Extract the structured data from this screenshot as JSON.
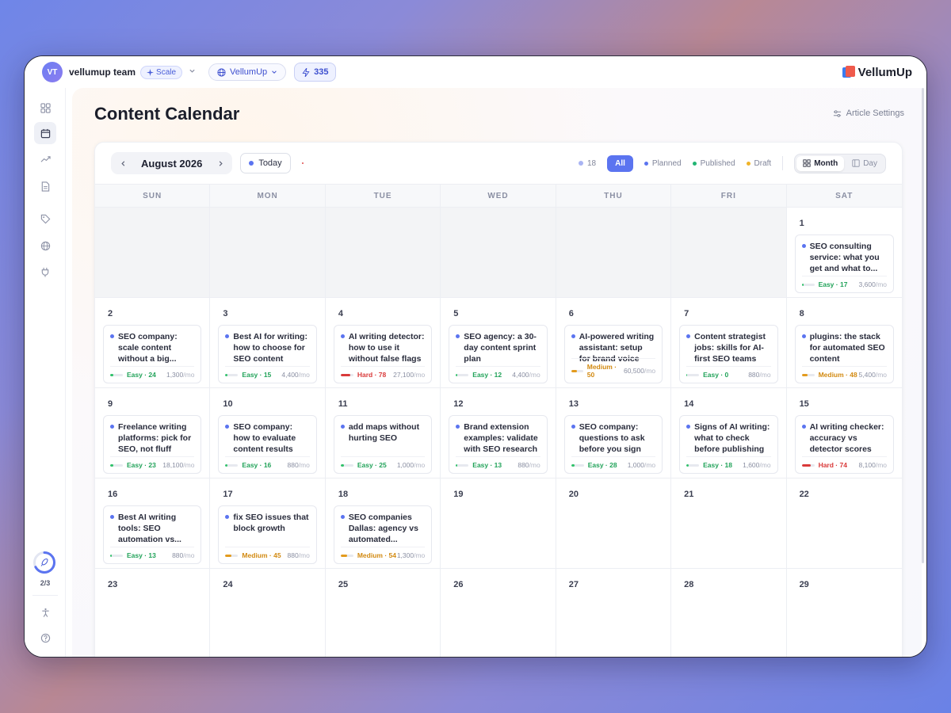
{
  "topbar": {
    "avatar_initials": "VT",
    "team_name": "vellumup team",
    "plan_label": "Scale",
    "workspace_label": "VellumUp",
    "credits": "335",
    "brand_name": "VellumUp"
  },
  "sidebar": {
    "progress_label": "2/3",
    "progress_fraction": 0.67
  },
  "page": {
    "title": "Content Calendar",
    "article_settings_label": "Article Settings"
  },
  "calendar": {
    "month_label": "August 2026",
    "today_label": "Today",
    "total_count": "18",
    "filters": {
      "all": "All",
      "planned": "Planned",
      "published": "Published",
      "draft": "Draft"
    },
    "views": {
      "month": "Month",
      "day": "Day"
    },
    "weekdays": [
      "SUN",
      "MON",
      "TUE",
      "WED",
      "THU",
      "FRI",
      "SAT"
    ],
    "leading_empty_days": 6,
    "days": [
      {
        "day": "1",
        "article": {
          "title": "SEO consulting service: what you get and what to...",
          "difficulty": "Easy · 17",
          "level": "easy",
          "score": 17,
          "volume": "3,600",
          "unit": "/mo"
        }
      },
      {
        "day": "2",
        "article": {
          "title": "SEO company: scale content without a big...",
          "difficulty": "Easy · 24",
          "level": "easy",
          "score": 24,
          "volume": "1,300",
          "unit": "/mo"
        }
      },
      {
        "day": "3",
        "article": {
          "title": "Best AI for writing: how to choose for SEO content",
          "difficulty": "Easy · 15",
          "level": "easy",
          "score": 15,
          "volume": "4,400",
          "unit": "/mo"
        }
      },
      {
        "day": "4",
        "article": {
          "title": "AI writing detector: how to use it without false flags",
          "difficulty": "Hard · 78",
          "level": "hard",
          "score": 78,
          "volume": "27,100",
          "unit": "/mo"
        }
      },
      {
        "day": "5",
        "article": {
          "title": "SEO agency: a 30-day content sprint plan",
          "difficulty": "Easy · 12",
          "level": "easy",
          "score": 12,
          "volume": "4,400",
          "unit": "/mo"
        }
      },
      {
        "day": "6",
        "article": {
          "title": "AI-powered writing assistant: setup for brand voice",
          "difficulty": "Medium · 50",
          "level": "medium",
          "score": 50,
          "volume": "60,500",
          "unit": "/mo"
        }
      },
      {
        "day": "7",
        "article": {
          "title": "Content strategist jobs: skills for AI-first SEO teams",
          "difficulty": "Easy · 0",
          "level": "easy",
          "score": 0,
          "volume": "880",
          "unit": "/mo"
        }
      },
      {
        "day": "8",
        "article": {
          "title": "plugins: the stack for automated SEO content",
          "difficulty": "Medium · 48",
          "level": "medium",
          "score": 48,
          "volume": "5,400",
          "unit": "/mo"
        }
      },
      {
        "day": "9",
        "article": {
          "title": "Freelance writing platforms: pick for SEO, not fluff",
          "difficulty": "Easy · 23",
          "level": "easy",
          "score": 23,
          "volume": "18,100",
          "unit": "/mo"
        }
      },
      {
        "day": "10",
        "article": {
          "title": "SEO company: how to evaluate content results",
          "difficulty": "Easy · 16",
          "level": "easy",
          "score": 16,
          "volume": "880",
          "unit": "/mo"
        }
      },
      {
        "day": "11",
        "article": {
          "title": "add maps without hurting SEO",
          "difficulty": "Easy · 25",
          "level": "easy",
          "score": 25,
          "volume": "1,000",
          "unit": "/mo"
        }
      },
      {
        "day": "12",
        "article": {
          "title": "Brand extension examples: validate with SEO research",
          "difficulty": "Easy · 13",
          "level": "easy",
          "score": 13,
          "volume": "880",
          "unit": "/mo"
        }
      },
      {
        "day": "13",
        "article": {
          "title": "SEO company: questions to ask before you sign",
          "difficulty": "Easy · 28",
          "level": "easy",
          "score": 28,
          "volume": "1,000",
          "unit": "/mo"
        }
      },
      {
        "day": "14",
        "article": {
          "title": "Signs of AI writing: what to check before publishing",
          "difficulty": "Easy · 18",
          "level": "easy",
          "score": 18,
          "volume": "1,600",
          "unit": "/mo"
        }
      },
      {
        "day": "15",
        "article": {
          "title": "AI writing checker: accuracy vs detector scores",
          "difficulty": "Hard · 74",
          "level": "hard",
          "score": 74,
          "volume": "8,100",
          "unit": "/mo"
        }
      },
      {
        "day": "16",
        "article": {
          "title": "Best AI writing tools: SEO automation vs...",
          "difficulty": "Easy · 13",
          "level": "easy",
          "score": 13,
          "volume": "880",
          "unit": "/mo"
        }
      },
      {
        "day": "17",
        "article": {
          "title": "fix SEO issues that block growth",
          "difficulty": "Medium · 45",
          "level": "medium",
          "score": 45,
          "volume": "880",
          "unit": "/mo"
        }
      },
      {
        "day": "18",
        "article": {
          "title": "SEO companies Dallas: agency vs automated...",
          "difficulty": "Medium · 54",
          "level": "medium",
          "score": 54,
          "volume": "1,300",
          "unit": "/mo"
        }
      },
      {
        "day": "19"
      },
      {
        "day": "20"
      },
      {
        "day": "21"
      },
      {
        "day": "22"
      },
      {
        "day": "23"
      },
      {
        "day": "24"
      },
      {
        "day": "25"
      },
      {
        "day": "26"
      },
      {
        "day": "27"
      },
      {
        "day": "28"
      },
      {
        "day": "29"
      }
    ]
  },
  "colors": {
    "accent": "#5b74f0",
    "planned": "#5b74f0",
    "published": "#22b573",
    "draft": "#f0b429",
    "easy": "#22a35a",
    "medium": "#d28a12",
    "hard": "#d93a3a"
  },
  "icons": [
    "sparkle-icon",
    "chevron-down-icon",
    "globe-icon",
    "bolt-icon",
    "grid-icon",
    "calendar-icon",
    "trending-icon",
    "document-icon",
    "tag-icon",
    "globe-icon",
    "plug-icon",
    "rocket-icon",
    "accessibility-icon",
    "help-icon",
    "sliders-icon",
    "chevron-left-icon",
    "chevron-right-icon"
  ]
}
